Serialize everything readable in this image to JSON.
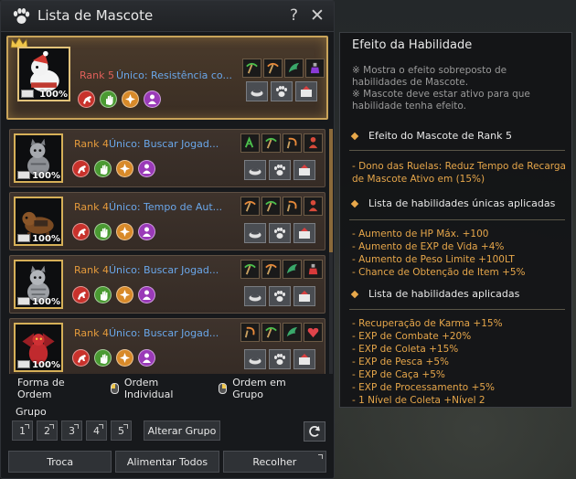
{
  "window": {
    "title": "Lista de Mascote",
    "help": "?",
    "close": "✕"
  },
  "pets": [
    {
      "rank": "Rank 5",
      "skill": "Único: Resistência co...",
      "percent": "100%",
      "skill_icons": [
        "pickaxe-green-icon",
        "pickaxe-orange-icon",
        "wing-green-icon",
        "potion-purple-icon"
      ]
    },
    {
      "rank": "Rank 4",
      "skill": "Único: Buscar Jogad...",
      "percent": "100%",
      "skill_icons": [
        "gatherer-icon",
        "pickaxe-green-icon",
        "sickle-orange-icon",
        "person-red-icon"
      ]
    },
    {
      "rank": "Rank 4",
      "skill": "Único: Tempo de Aut...",
      "percent": "100%",
      "skill_icons": [
        "pickaxe-orange-icon",
        "pickaxe-green-icon",
        "sickle-orange-icon",
        "person-red-icon"
      ]
    },
    {
      "rank": "Rank 4",
      "skill": "Único: Buscar Jogad...",
      "percent": "100%",
      "skill_icons": [
        "pickaxe-green-icon",
        "pickaxe-orange-icon",
        "wing-green-icon",
        "potion-red-icon"
      ]
    },
    {
      "rank": "Rank 4",
      "skill": "Único: Buscar Jogad...",
      "percent": "100%",
      "skill_icons": [
        "sickle-orange-icon",
        "pickaxe-green-icon",
        "wing-green-icon",
        "heart-red-icon"
      ]
    }
  ],
  "sort": {
    "label": "Forma de Ordem",
    "individual": "Ordem Individual",
    "group": "Ordem em Grupo"
  },
  "group": {
    "label": "Grupo",
    "buttons": [
      "1",
      "2",
      "3",
      "4",
      "5"
    ],
    "change": "Alterar Grupo"
  },
  "bottom": {
    "trade": "Troca",
    "feed_all": "Alimentar Todos",
    "collect": "Recolher"
  },
  "tooltip": {
    "title": "Efeito da Habilidade",
    "notes": [
      "※ Mostra o efeito sobreposto de habilidades de Mascote.",
      "※ Mascote deve estar ativo para que habilidade tenha efeito."
    ],
    "rank_section": "Efeito do Mascote de Rank 5",
    "rank_effect": "- Dono das Ruelas: Reduz Tempo de Recarga de Mascote Ativo em (15%)",
    "unique_section": "Lista de habilidades únicas aplicadas",
    "unique_items": [
      "- Aumento de HP Máx. +100",
      "- Aumento de EXP de Vida +4%",
      "- Aumento de Peso Limite +100LT",
      "- Chance de Obtenção de Item +5%"
    ],
    "applied_section": "Lista de habilidades aplicadas",
    "applied_items": [
      "- Recuperação de Karma +15%",
      "- EXP de Combate +20%",
      "- EXP de Coleta +15%",
      "- EXP de Pesca +5%",
      "- EXP de Caça +5%",
      "- EXP de Processamento +5%",
      "- 1 Nível de Coleta +Nível 2"
    ]
  },
  "colors": {
    "rank_highlight": "#e0605a",
    "rank_normal": "#e49a3c",
    "skill_text": "#6aa7ea",
    "tooltip_body": "#e6a64a",
    "card_gold_border": "#c9a45a"
  }
}
